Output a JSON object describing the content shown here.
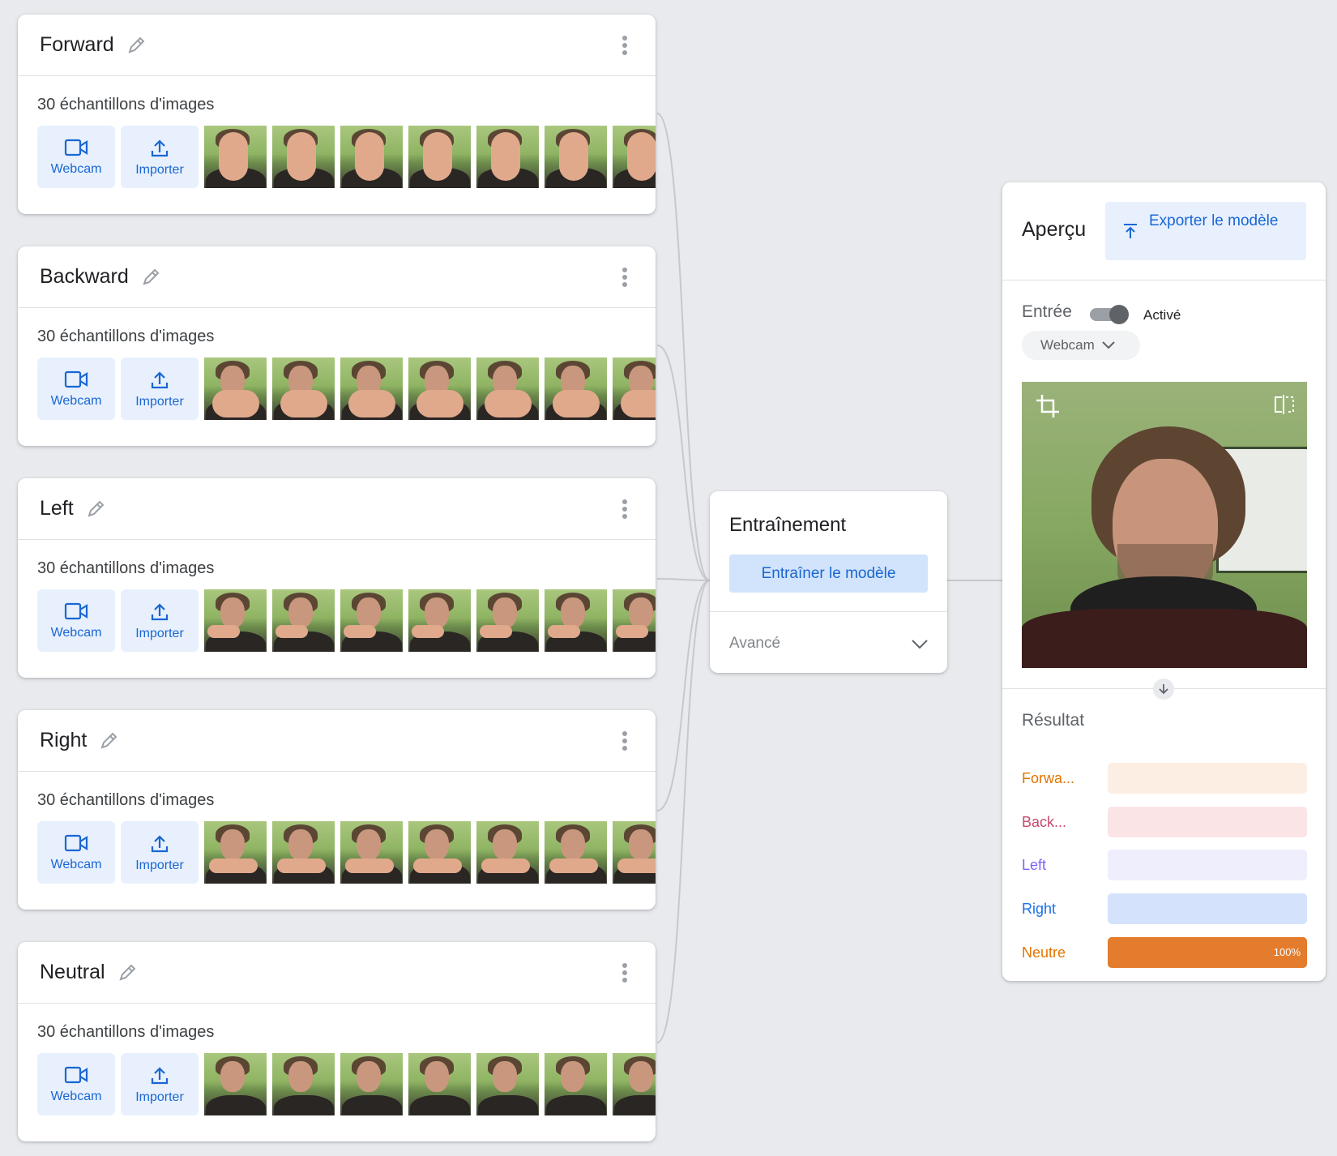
{
  "classes": [
    {
      "name": "Forward",
      "samples": "30 échantillons d'images",
      "pose": "palm"
    },
    {
      "name": "Backward",
      "samples": "30 échantillons d'images",
      "pose": "back"
    },
    {
      "name": "Left",
      "samples": "30 échantillons d'images",
      "pose": "left"
    },
    {
      "name": "Right",
      "samples": "30 échantillons d'images",
      "pose": "right"
    },
    {
      "name": "Neutral",
      "samples": "30 échantillons d'images",
      "pose": "none"
    }
  ],
  "sample_buttons": {
    "webcam": "Webcam",
    "upload": "Importer"
  },
  "training": {
    "title": "Entraînement",
    "train_button": "Entraîner le modèle",
    "advanced": "Avancé"
  },
  "preview": {
    "title": "Aperçu",
    "export_button": "Exporter le modèle",
    "input_label": "Entrée",
    "toggle_state": "Activé",
    "toggle_on": true,
    "source": "Webcam",
    "result_label": "Résultat",
    "results": [
      {
        "label": "Forwa...",
        "value": 0,
        "pct": "",
        "color": "#e37400",
        "bg": "#fdeee3",
        "text_color": "#e37400"
      },
      {
        "label": "Back...",
        "value": 0,
        "pct": "",
        "color": "#c5221f",
        "bg": "#fbe4e6",
        "text_color": "#c84b6e"
      },
      {
        "label": "Left",
        "value": 0,
        "pct": "",
        "color": "#7b61ff",
        "bg": "#efeefc",
        "text_color": "#7b61ff"
      },
      {
        "label": "Right",
        "value": 0,
        "pct": "",
        "color": "#1a73e8",
        "bg": "#d4e3fb",
        "text_color": "#1a73e8"
      },
      {
        "label": "Neutre",
        "value": 1,
        "pct": "100%",
        "color": "#e37c2c",
        "bg": "#fce8d8",
        "text_color": "#e37400"
      }
    ]
  },
  "colors": {
    "accent": "#1967d2",
    "accent_bg": "#e8f0fe",
    "background": "#e8eaed"
  }
}
